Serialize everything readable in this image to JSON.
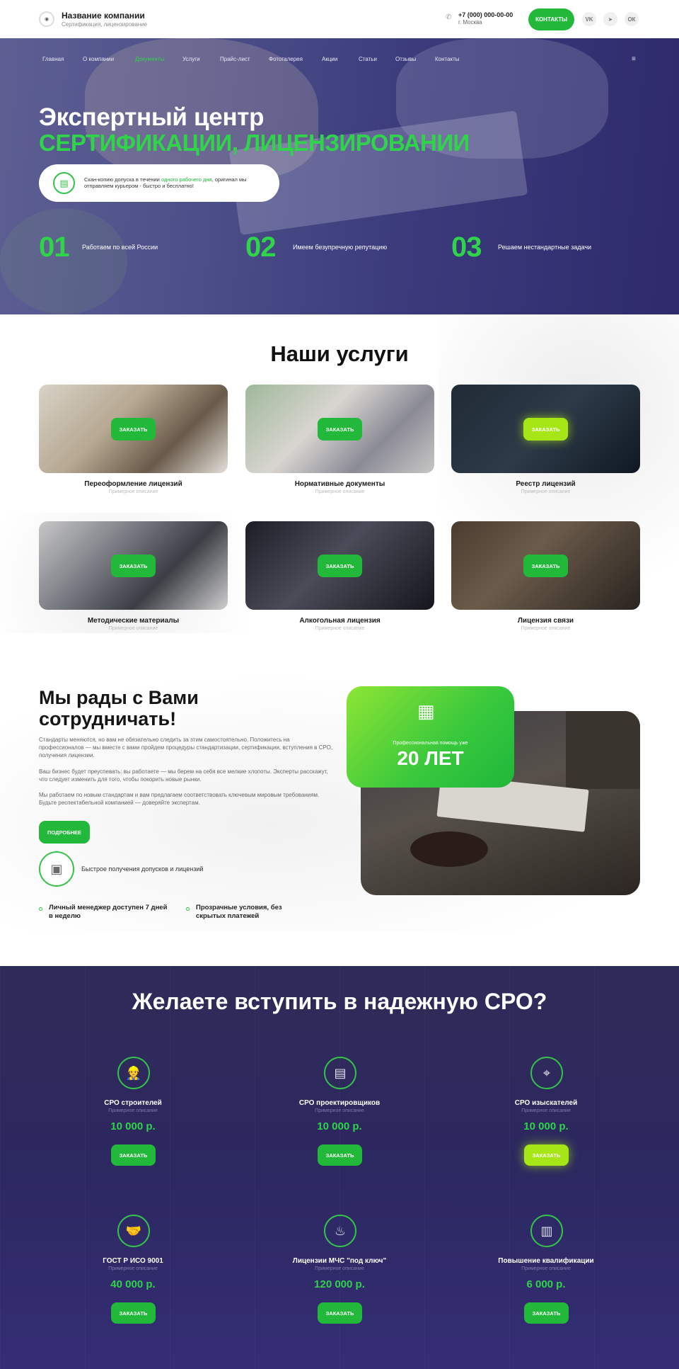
{
  "header": {
    "company_name": "Название компании",
    "company_sub": "Сертификация, лицензирование",
    "phone": "+7 (000) 000-00-00",
    "city": "г. Москва",
    "contacts_button": "КОНТАКТЫ",
    "socials": [
      "VK",
      "telegram",
      "ok"
    ]
  },
  "nav": {
    "items": [
      "Главная",
      "О компании",
      "Документы",
      "Услуги",
      "Прайс-лист",
      "Фотогалерея",
      "Акции",
      "Статьи",
      "Отзывы",
      "Контакты"
    ],
    "active_index": 2
  },
  "hero": {
    "title_line1": "Экспертный центр",
    "title_line2": "СЕРТИФИКАЦИИ, ЛИЦЕНЗИРОВАНИИ",
    "pill_text_before": "Скан-копию допуска в течении ",
    "pill_text_highlight": "одного рабочего дня",
    "pill_text_after": ", оригинал мы отправляем курьером - быстро и бесплатно!",
    "stats": [
      {
        "num": "01",
        "label": "Работаем по всей России"
      },
      {
        "num": "02",
        "label": "Имеем безупречную репутацию"
      },
      {
        "num": "03",
        "label": "Решаем нестандартные задачи"
      }
    ]
  },
  "services": {
    "title": "Наши услуги",
    "order_label": "ЗАКАЗАТЬ",
    "items": [
      {
        "title": "Переоформление лицензий",
        "sub": "Примерное описание"
      },
      {
        "title": "Нормативные документы",
        "sub": "Примерное описание"
      },
      {
        "title": "Реестр лицензий",
        "sub": "Примерное описание"
      },
      {
        "title": "Методические материалы",
        "sub": "Примерное описание"
      },
      {
        "title": "Алкогольная лицензия",
        "sub": "Примерное описание"
      },
      {
        "title": "Лицензия связи",
        "sub": "Примерное описание"
      }
    ]
  },
  "about": {
    "title": "Мы рады с Вами сотрудничать!",
    "p1": "Стандарты меняются, но вам не обязательно следить за этим самостоятельно. Положитесь на профессионалов — мы вместе с вами пройдем процедуры стандартизации, сертификации, вступления в СРО, получения лицензии.",
    "p2": "Ваш бизнес будет преуспевать: вы работаете — мы берем на себя все мелкие хлопоты. Эксперты расскажут, что следует изменить для того, чтобы покорить новые рынки.",
    "p3": "Мы работаем по новым стандартам и вам предлагаем соответствовать ключевым мировым требованиям. Будьте респектабельной компанией — доверяйте экспертам.",
    "more_button": "ПОДРОБНЕЕ",
    "icon_text": "Быстрое получения допусков и лицензий",
    "features": [
      "Личный менеджер доступен 7 дней в неделю",
      "Прозрачные условия, без скрытых платежей"
    ],
    "badge_caption": "Профессиональная помощь уже",
    "badge_value": "20 ЛЕТ"
  },
  "sro": {
    "title": "Желаете вступить в надежную СРО?",
    "order_label": "ЗАКАЗАТЬ",
    "items": [
      {
        "title": "СРО строителей",
        "sub": "Примерное описание",
        "price": "10 000 р.",
        "icon": "builder-icon"
      },
      {
        "title": "СРО проектировщиков",
        "sub": "Примерное описание",
        "price": "10 000 р.",
        "icon": "blueprint-icon"
      },
      {
        "title": "СРО изыскателей",
        "sub": "Примерное описание",
        "price": "10 000 р.",
        "icon": "surveyor-icon"
      },
      {
        "title": "ГОСТ Р ИСО 9001",
        "sub": "Примерное описание",
        "price": "40 000 р.",
        "icon": "handshake-icon"
      },
      {
        "title": "Лицензии МЧС \"под ключ\"",
        "sub": "Примерное описание",
        "price": "120 000 р.",
        "icon": "fire-icon"
      },
      {
        "title": "Повышение квалификации",
        "sub": "Примерное описание",
        "price": "6 000  р.",
        "icon": "certificate-icon"
      }
    ]
  },
  "colors": {
    "accent": "#22b83a",
    "lime": "#a6e516",
    "dark": "#2f2b58"
  }
}
